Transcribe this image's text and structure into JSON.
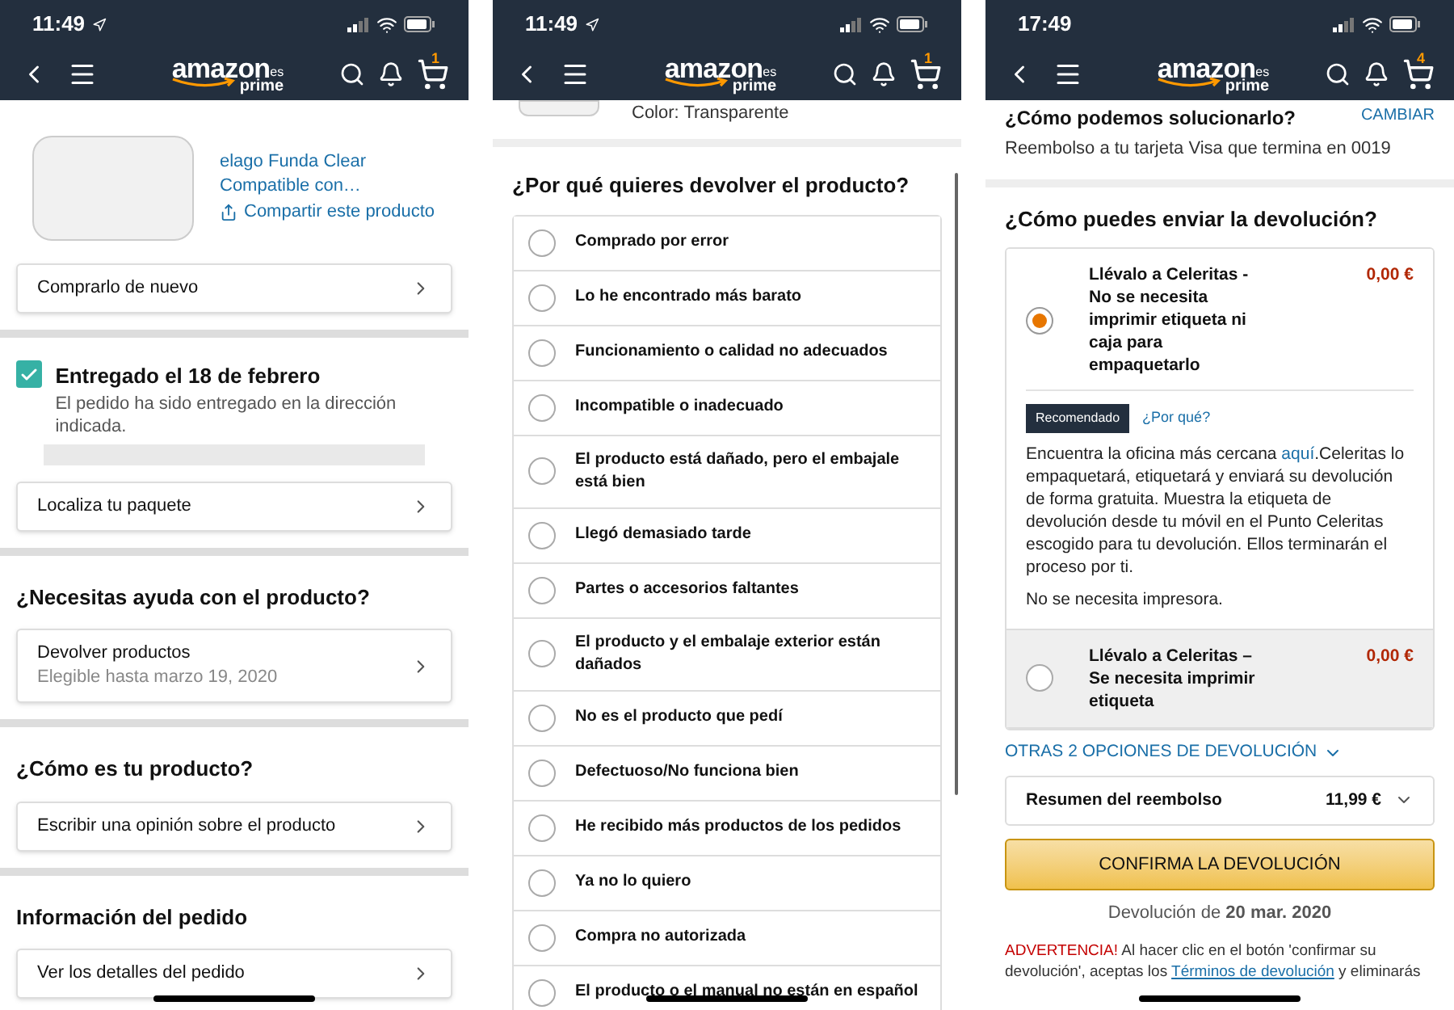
{
  "phones": [
    {
      "kind": "order",
      "status": {
        "time": "11:49",
        "location": true
      },
      "header": {
        "logo": "amazon",
        "logo_suffix": "es",
        "logo_sub": "prime",
        "cart_count": "1"
      },
      "product": {
        "title": "elago Funda Clear Compatible con…",
        "share": "Compartir este producto"
      },
      "buy_again": "Comprarlo de nuevo",
      "delivery": {
        "checked": true,
        "title": "Entregado el 18 de febrero",
        "text": "El pedido ha sido entregado en la dirección indicada."
      },
      "track": "Localiza tu paquete",
      "sections": [
        {
          "heading": "¿Necesitas ayuda con el producto?",
          "row": {
            "label": "Devolver productos",
            "sub": "Elegible hasta marzo 19, 2020"
          }
        },
        {
          "heading": "¿Cómo es tu producto?",
          "row": {
            "label": "Escribir una opinión sobre el producto"
          }
        },
        {
          "heading": "Información del pedido",
          "row": {
            "label": "Ver los detalles del pedido"
          }
        }
      ]
    },
    {
      "kind": "reasons",
      "status": {
        "time": "11:49",
        "location": true
      },
      "header": {
        "logo": "amazon",
        "logo_suffix": "es",
        "logo_sub": "prime",
        "cart_count": "1"
      },
      "variant": "Color: Transparente",
      "heading": "¿Por qué quieres devolver el producto?",
      "reasons": [
        {
          "label": "Comprado por error",
          "selected": false
        },
        {
          "label": "Lo he encontrado más barato",
          "selected": false
        },
        {
          "label": "Funcionamiento o calidad no adecuados",
          "selected": false
        },
        {
          "label": "Incompatible o inadecuado",
          "selected": false
        },
        {
          "label": "El producto está dañado, pero el embajale está bien",
          "selected": false
        },
        {
          "label": "Llegó demasiado tarde",
          "selected": false
        },
        {
          "label": "Partes o accesorios faltantes",
          "selected": false
        },
        {
          "label": "El producto y el embalaje exterior están dañados",
          "selected": false
        },
        {
          "label": "No es el producto que pedí",
          "selected": false
        },
        {
          "label": "Defectuoso/No funciona bien",
          "selected": false
        },
        {
          "label": "He recibido más productos de los pedidos",
          "selected": false
        },
        {
          "label": "Ya no lo quiero",
          "selected": false
        },
        {
          "label": "Compra no autorizada",
          "selected": false
        },
        {
          "label": "El producto o el manual no están en español",
          "selected": false
        }
      ]
    },
    {
      "kind": "shipping",
      "status": {
        "time": "17:49",
        "location": false
      },
      "header": {
        "logo": "amazon",
        "logo_suffix": "es",
        "logo_sub": "prime",
        "cart_count": "4"
      },
      "refund": {
        "heading": "¿Cómo podemos solucionarlo?",
        "change": "CAMBIAR",
        "text": "Reembolso a tu tarjeta Visa que termina en 0019"
      },
      "heading": "¿Cómo puedes enviar la devolución?",
      "options": [
        {
          "selected": true,
          "title": "Llévalo a Celeritas - No se necesita imprimir etiqueta ni caja para empaquetarlo",
          "price": "0,00 €",
          "badge": "Recomendado",
          "why": "¿Por qué?",
          "text_before": "Encuentra la oficina más cercana ",
          "link": "aquí",
          "text_after": ".Celeritas lo empaquetará, etiquetará y enviará su devolución de forma gratuita. Muestra la etiqueta de devolución desde tu móvil en el Punto Celeritas escogido para tu devolución. Ellos terminarán el proceso por ti.",
          "note": "No se necesita impresora."
        },
        {
          "selected": false,
          "title": "Llévalo a Celeritas – Se necesita imprimir etiqueta",
          "price": "0,00 €"
        }
      ],
      "more": "OTRAS 2 OPCIONES DE DEVOLUCIÓN",
      "summary": {
        "label": "Resumen del reembolso",
        "amount": "11,99 €"
      },
      "confirm": "CONFIRMA LA DEVOLUCIÓN",
      "return_date": "Devolución de **20 mar. 2020**",
      "warning": {
        "alert": "ADVERTENCIA!",
        "before": "Al hacer clic en el botón 'confirmar su devolución', aceptas los ",
        "link": "Términos de devolución",
        "after": " y eliminarás"
      }
    }
  ]
}
